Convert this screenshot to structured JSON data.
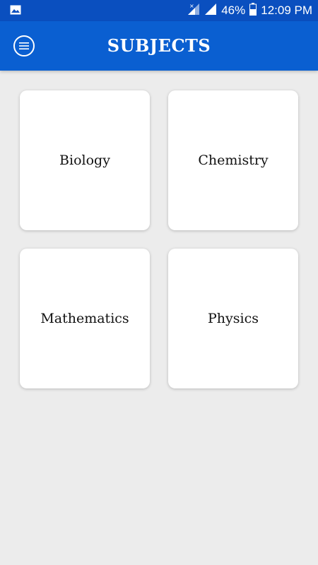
{
  "status_bar": {
    "battery_percent": "46%",
    "time": "12:09 PM",
    "left_icon": "image-icon",
    "right_icons": [
      "signal-no-data-icon",
      "signal-icon",
      "battery-icon"
    ]
  },
  "app_bar": {
    "title": "SUBJECTS",
    "menu_icon": "menu-icon",
    "color": "#0a5fd1"
  },
  "subjects": [
    {
      "label": "Biology"
    },
    {
      "label": "Chemistry"
    },
    {
      "label": "Mathematics"
    },
    {
      "label": "Physics"
    }
  ]
}
